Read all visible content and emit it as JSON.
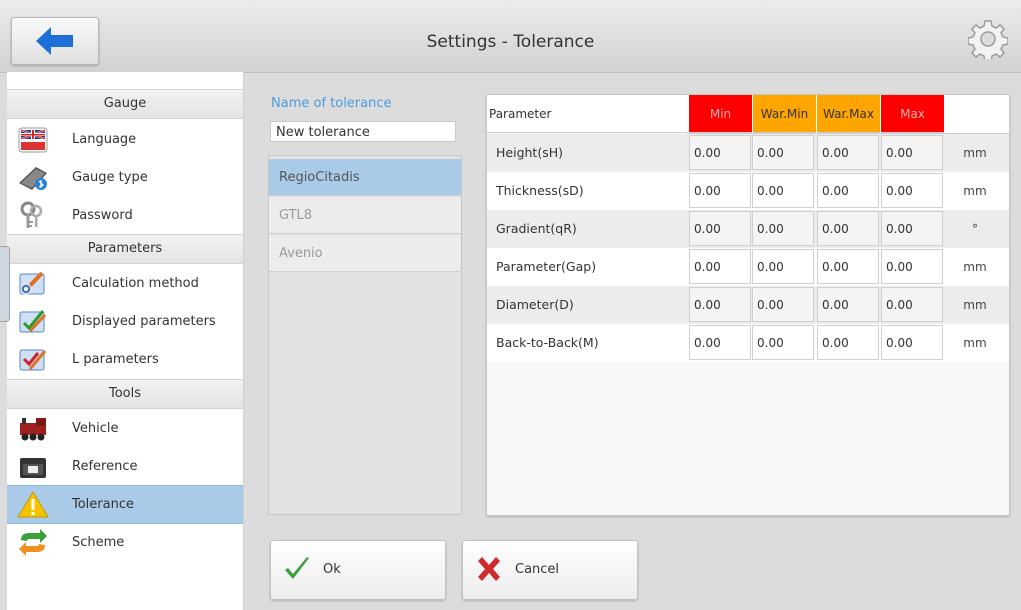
{
  "header": {
    "title": "Settings - Tolerance"
  },
  "sidebar": {
    "sections": [
      {
        "label": "Gauge",
        "items": [
          {
            "label": "Language",
            "icon": "uk-flag-icon"
          },
          {
            "label": "Gauge type",
            "icon": "gauge-device-icon"
          },
          {
            "label": "Password",
            "icon": "keys-icon"
          }
        ]
      },
      {
        "label": "Parameters",
        "items": [
          {
            "label": "Calculation method",
            "icon": "calculation-icon"
          },
          {
            "label": "Displayed parameters",
            "icon": "checklist-icon"
          },
          {
            "label": "L parameters",
            "icon": "checklist-l-icon"
          }
        ]
      },
      {
        "label": "Tools",
        "items": [
          {
            "label": "Vehicle",
            "icon": "locomotive-icon"
          },
          {
            "label": "Reference",
            "icon": "reference-device-icon"
          },
          {
            "label": "Tolerance",
            "icon": "warning-icon"
          },
          {
            "label": "Scheme",
            "icon": "arrows-cycle-icon"
          }
        ]
      }
    ],
    "active": "Tolerance"
  },
  "form": {
    "name_label": "Name of tolerance",
    "name_value": "New tolerance",
    "tolerances": [
      "RegioCitadis",
      "GTL8",
      "Avenio"
    ],
    "selected": "RegioCitadis"
  },
  "table": {
    "headers": {
      "parameter": "Parameter",
      "min": "Min",
      "war_min": "War.Min",
      "war_max": "War.Max",
      "max": "Max"
    },
    "header_colors": {
      "min": "#ff0000",
      "war_min": "#ffa500",
      "war_max": "#ffa500",
      "max": "#ff0000"
    },
    "rows": [
      {
        "label": "Height(sH)",
        "min": "0.00",
        "war_min": "0.00",
        "war_max": "0.00",
        "max": "0.00",
        "unit": "mm"
      },
      {
        "label": "Thickness(sD)",
        "min": "0.00",
        "war_min": "0.00",
        "war_max": "0.00",
        "max": "0.00",
        "unit": "mm"
      },
      {
        "label": "Gradient(qR)",
        "min": "0.00",
        "war_min": "0.00",
        "war_max": "0.00",
        "max": "0.00",
        "unit": "°"
      },
      {
        "label": "Parameter(Gap)",
        "min": "0.00",
        "war_min": "0.00",
        "war_max": "0.00",
        "max": "0.00",
        "unit": "mm"
      },
      {
        "label": "Diameter(D)",
        "min": "0.00",
        "war_min": "0.00",
        "war_max": "0.00",
        "max": "0.00",
        "unit": "mm"
      },
      {
        "label": "Back-to-Back(M)",
        "min": "0.00",
        "war_min": "0.00",
        "war_max": "0.00",
        "max": "0.00",
        "unit": "mm"
      }
    ]
  },
  "buttons": {
    "ok_label": "Ok",
    "cancel_label": "Cancel"
  },
  "colors": {
    "accent": "#4a9be0",
    "selection": "#a9cbe8",
    "back_arrow": "#1e6fd9"
  }
}
